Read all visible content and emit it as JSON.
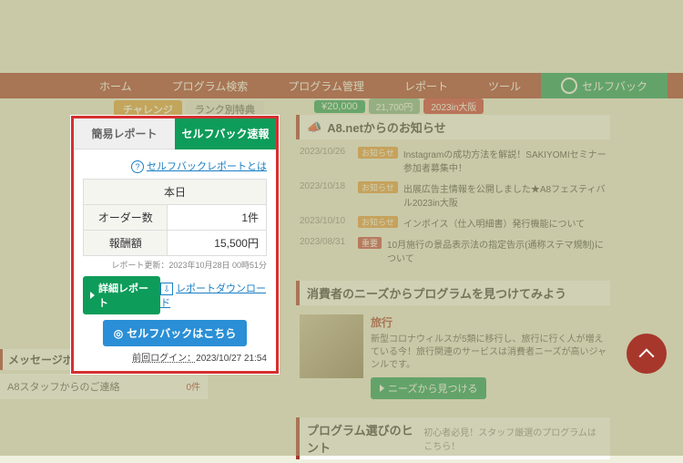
{
  "nav": {
    "home": "ホーム",
    "program_search": "プログラム検索",
    "program_manage": "プログラム管理",
    "report": "レポート",
    "tools": "ツール",
    "selfback": "セルフバック"
  },
  "pills": {
    "challenge": "チャレンジ",
    "rank": "ランク別特典"
  },
  "prices": {
    "p1": "¥20,000",
    "p2": "21,700円",
    "p3": "2023in大阪"
  },
  "panel": {
    "tab_simple": "簡易レポート",
    "tab_selfback": "セルフバック速報",
    "help": "セルフバックレポートとは",
    "today": "本日",
    "orders_label": "オーダー数",
    "orders_val": "1件",
    "amount_label": "報酬額",
    "amount_val": "15,500円",
    "updated": "レポート更新：2023年10月28日 00時51分",
    "detail_btn": "詳細レポート",
    "dl": "レポートダウンロード",
    "goto_selfback": "セルフバックはこちら",
    "last_login_label": "前回ログイン：",
    "last_login_val": "2023/10/27 21:54"
  },
  "news": {
    "title": "A8.netからのお知らせ",
    "items": [
      {
        "date": "2023/10/26",
        "badge": "お知らせ",
        "text": "Instagramの成功方法を解説！SAKIYOMIセミナー参加者募集中！"
      },
      {
        "date": "2023/10/18",
        "badge": "お知らせ",
        "text": "出展広告主情報を公開しました★A8フェスティバル2023in大阪"
      },
      {
        "date": "2023/10/10",
        "badge": "お知らせ",
        "text": "インボイス（仕入明細書）発行機能について"
      },
      {
        "date": "2023/08/31",
        "badge": "重要",
        "badge_red": true,
        "text": "10月施行の景品表示法の指定告示(通称ステマ規制)について"
      }
    ]
  },
  "needs": {
    "title": "消費者のニーズからプログラムを見つけてみよう",
    "item_title": "旅行",
    "item_desc": "新型コロナウィルスが5類に移行し、旅行に行く人が増えている今！旅行関連のサービスは消費者ニーズが高いジャンルです。",
    "btn": "ニーズから見つける"
  },
  "hint": {
    "title": "プログラム選びのヒント",
    "sub": "初心者必見！スタッフ厳選のプログラムはこちら！"
  },
  "msgbox": {
    "title": "メッセージボックス",
    "row": "A8スタッフからのご連絡",
    "count": "0件"
  }
}
